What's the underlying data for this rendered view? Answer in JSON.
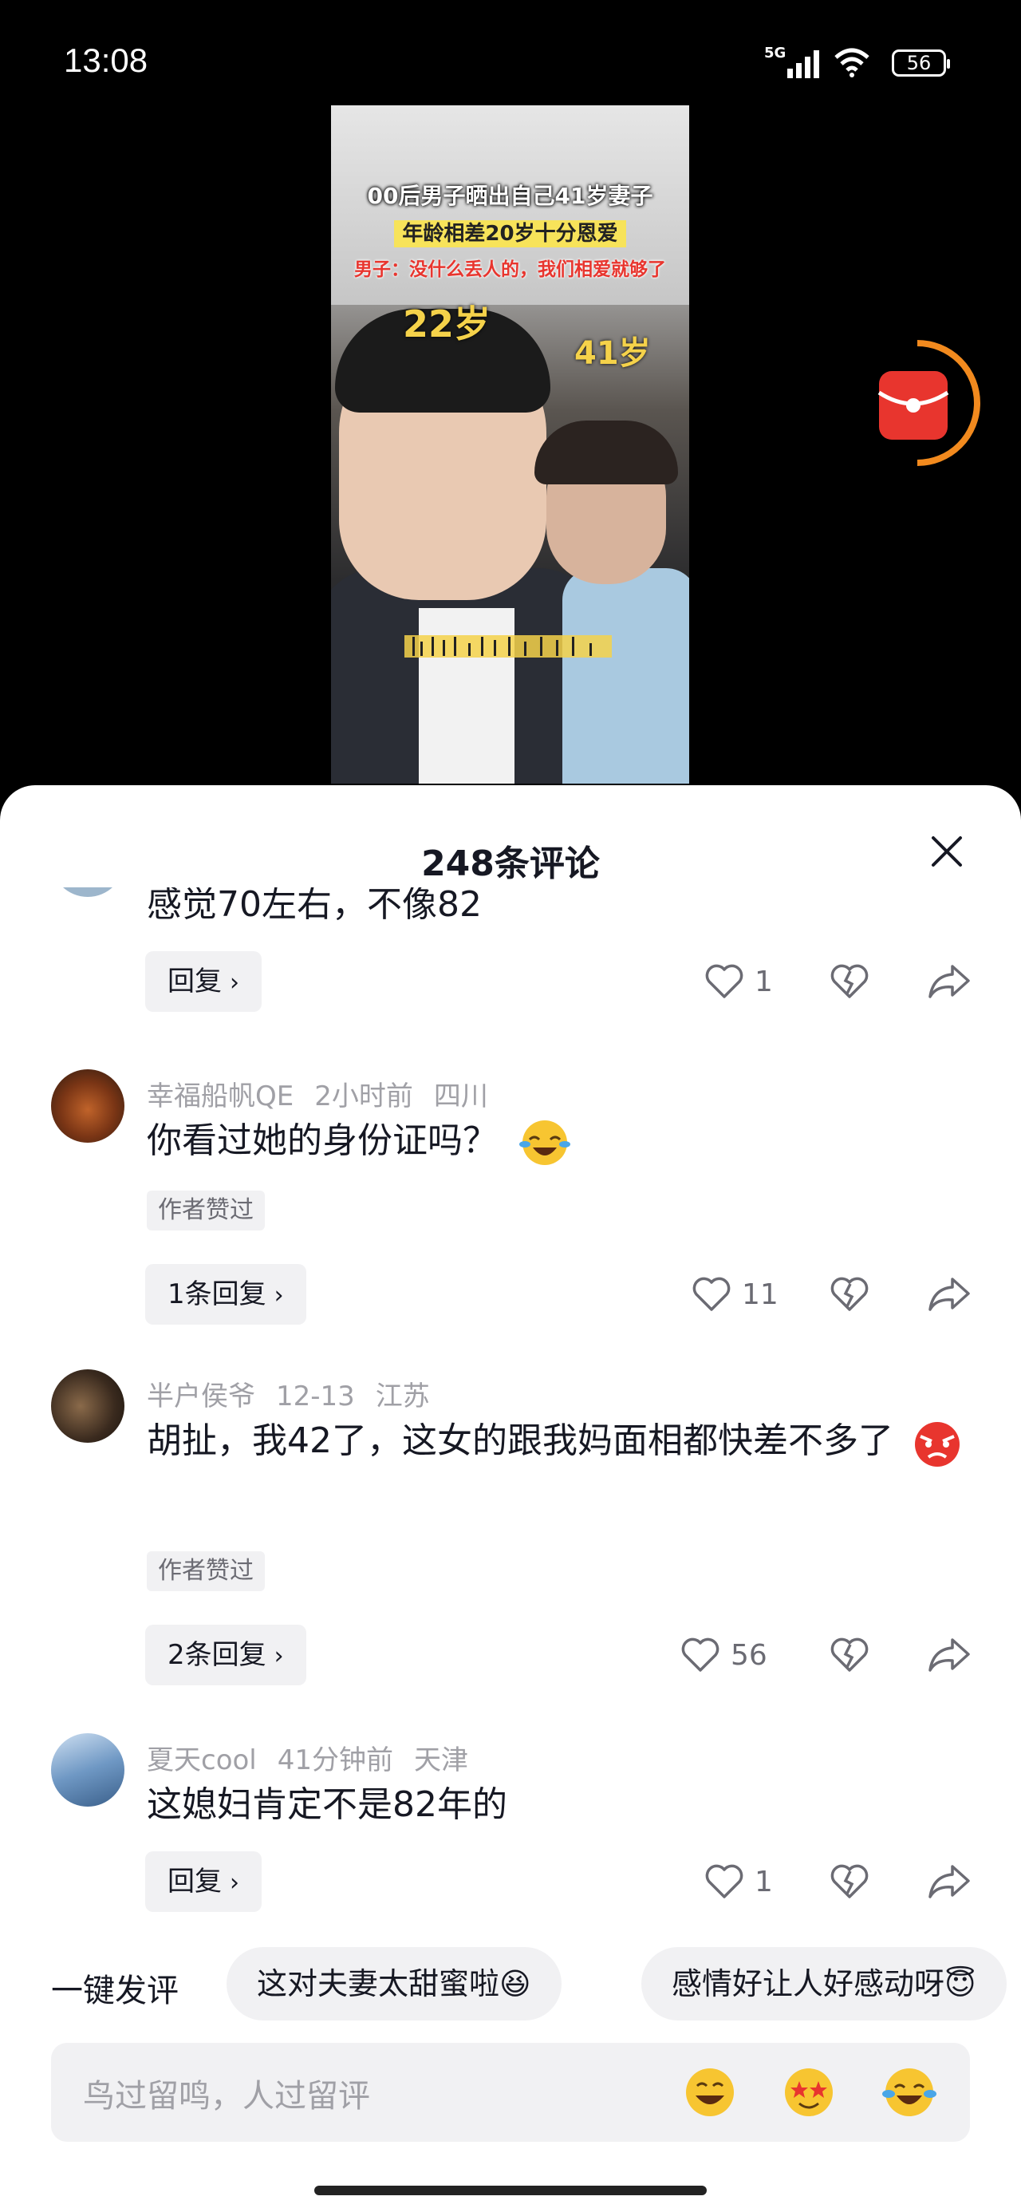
{
  "status_bar": {
    "time": "13:08",
    "network": "5G",
    "battery": "56"
  },
  "video": {
    "title_line1": "00后男子晒出自己41岁妻子",
    "title_line2": "年龄相差20岁十分恩爱",
    "title_line3": "男子：没什么丢人的，我们相爱就够了",
    "age_left": "22岁",
    "age_right": "41岁"
  },
  "sheet": {
    "title": "248条评论"
  },
  "comments": [
    {
      "text": "感觉70左右，不像82",
      "reply_label": "回复",
      "likes": "1"
    },
    {
      "user": "幸福船帆QE",
      "time": "2小时前",
      "location": "四川",
      "text": "你看过她的身份证吗？",
      "tag": "作者赞过",
      "reply_label": "1条回复",
      "likes": "11"
    },
    {
      "user": "半户侯爷",
      "time": "12-13",
      "location": "江苏",
      "text": "胡扯，我42了，这女的跟我妈面相都快差不多了",
      "tag": "作者赞过",
      "reply_label": "2条回复",
      "likes": "56"
    },
    {
      "user": "夏天cool",
      "time": "41分钟前",
      "location": "天津",
      "text": "这媳妇肯定不是82年的",
      "reply_label": "回复",
      "likes": "1"
    }
  ],
  "quick_comment": {
    "label": "一键发评",
    "chips": [
      "这对夫妻太甜蜜啦😆",
      "感情好让人好感动呀😇"
    ]
  },
  "input": {
    "placeholder": "鸟过留鸣，人过留评"
  },
  "colors": {
    "accent_orange": "#f28a1e",
    "red": "#e8352e",
    "text_dark": "#161823",
    "text_gray": "#a0a0a6"
  }
}
